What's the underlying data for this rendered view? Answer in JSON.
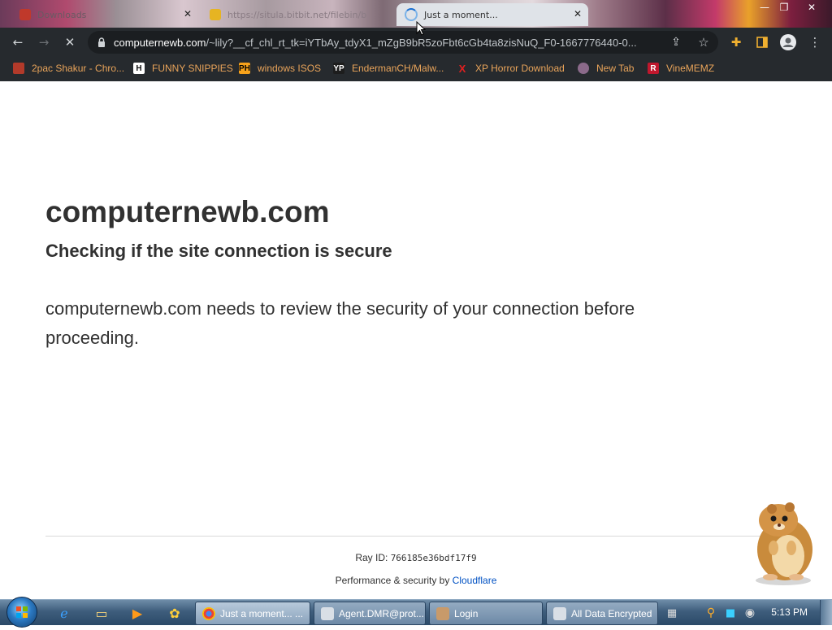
{
  "tabs": [
    {
      "title": "Downloads"
    },
    {
      "title": "https://situla.bitbit.net/filebin/b"
    },
    {
      "title": "Just a moment..."
    }
  ],
  "toolbar": {
    "url_host": "computernewb.com",
    "url_rest": "/~lily?__cf_chl_rt_tk=iYTbAy_tdyX1_mZgB9bR5zoFbt6cGb4ta8zisNuQ_F0-1667776440-0..."
  },
  "bookmarks": [
    {
      "label": "2pac Shakur - Chro...",
      "icon": "drum-icon"
    },
    {
      "label": "FUNNY SNIPPIES",
      "icon": "h-icon"
    },
    {
      "label": "windows ISOS",
      "icon": "ph-icon"
    },
    {
      "label": "EndermanCH/Malw...",
      "icon": "yp-icon"
    },
    {
      "label": "XP Horror Download",
      "icon": "x-icon"
    },
    {
      "label": "New Tab",
      "icon": "globe-icon"
    },
    {
      "label": "VineMEMZ",
      "icon": "r-icon"
    }
  ],
  "page": {
    "host": "computernewb.com",
    "heading": "Checking if the site connection is secure",
    "paragraph": "computernewb.com needs to review the security of your connection before proceeding.",
    "ray_label": "Ray ID:",
    "ray_id": "766185e36bdf17f9",
    "perf_label": "Performance & security by",
    "perf_link": "Cloudflare"
  },
  "taskbar": {
    "tasks": [
      {
        "label": "Just a moment... ..."
      },
      {
        "label": "Agent.DMR@prot..."
      },
      {
        "label": "Login"
      },
      {
        "label": "All Data Encrypted"
      }
    ],
    "clock": "5:13 PM"
  },
  "colors": {
    "toolbar": "#262a2e",
    "bookmark_text": "#e9a45a",
    "link": "#0051c3",
    "page_text": "#313131"
  }
}
